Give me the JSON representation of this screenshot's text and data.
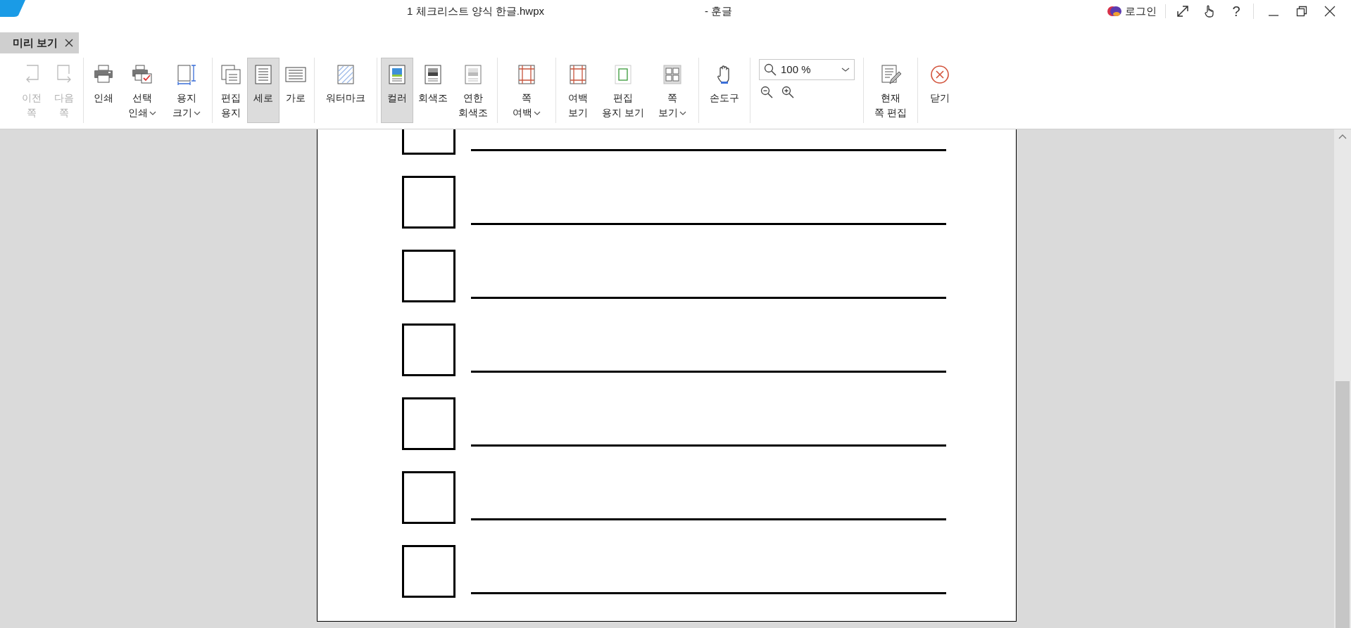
{
  "window": {
    "title": "1 체크리스트 양식 한글.hwpx",
    "app_name": "- 훈글",
    "login": "로그인",
    "help": "?"
  },
  "tabs": [
    {
      "label": "미리 보기",
      "selected": true
    }
  ],
  "toolbar": [
    {
      "kind": "buttons",
      "items": [
        {
          "lines": [
            "이전",
            "쪽"
          ],
          "disabled": true,
          "selected": false,
          "dropdown": false
        },
        {
          "lines": [
            "다음",
            "쪽"
          ],
          "disabled": true,
          "selected": false,
          "dropdown": false
        }
      ]
    },
    {
      "kind": "buttons",
      "items": [
        {
          "lines": [
            "인쇄"
          ],
          "disabled": false,
          "selected": false,
          "dropdown": false
        },
        {
          "lines": [
            "선택",
            "인쇄"
          ],
          "disabled": false,
          "selected": false,
          "dropdown": true
        },
        {
          "lines": [
            "용지",
            "크기"
          ],
          "disabled": false,
          "selected": false,
          "dropdown": true
        }
      ]
    },
    {
      "kind": "buttons",
      "items": [
        {
          "lines": [
            "편집",
            "용지"
          ],
          "disabled": false,
          "selected": false,
          "dropdown": false
        },
        {
          "lines": [
            "세로"
          ],
          "disabled": false,
          "selected": true,
          "dropdown": false
        },
        {
          "lines": [
            "가로"
          ],
          "disabled": false,
          "selected": false,
          "dropdown": false
        }
      ]
    },
    {
      "kind": "buttons",
      "items": [
        {
          "lines": [
            "워터마크"
          ],
          "disabled": false,
          "selected": false,
          "dropdown": false
        }
      ]
    },
    {
      "kind": "buttons",
      "items": [
        {
          "lines": [
            "컬러"
          ],
          "disabled": false,
          "selected": true,
          "dropdown": false
        },
        {
          "lines": [
            "회색조"
          ],
          "disabled": false,
          "selected": false,
          "dropdown": false
        },
        {
          "lines": [
            "연한",
            "회색조"
          ],
          "disabled": false,
          "selected": false,
          "dropdown": false
        }
      ]
    },
    {
      "kind": "buttons",
      "items": [
        {
          "lines": [
            "쪽",
            "여백"
          ],
          "disabled": false,
          "selected": false,
          "dropdown": true
        }
      ]
    },
    {
      "kind": "buttons",
      "items": [
        {
          "lines": [
            "여백",
            "보기"
          ],
          "disabled": false,
          "selected": false,
          "dropdown": false
        },
        {
          "lines": [
            "편집",
            "용지 보기"
          ],
          "disabled": false,
          "selected": false,
          "dropdown": false
        },
        {
          "lines": [
            "쪽",
            "보기"
          ],
          "disabled": false,
          "selected": false,
          "dropdown": true
        }
      ]
    },
    {
      "kind": "buttons",
      "items": [
        {
          "lines": [
            "손도구"
          ],
          "disabled": false,
          "selected": false,
          "dropdown": false
        }
      ]
    },
    {
      "kind": "zoom",
      "value": "100 %"
    },
    {
      "kind": "buttons",
      "items": [
        {
          "lines": [
            "현재",
            "쪽 편집"
          ],
          "disabled": false,
          "selected": false,
          "dropdown": false
        }
      ]
    },
    {
      "kind": "buttons",
      "items": [
        {
          "lines": [
            "닫기"
          ],
          "disabled": false,
          "selected": false,
          "dropdown": false
        }
      ]
    }
  ],
  "checklist": [
    {
      "checked": false
    },
    {
      "checked": false
    },
    {
      "checked": false
    },
    {
      "checked": false
    },
    {
      "checked": false
    },
    {
      "checked": false
    },
    {
      "checked": false
    }
  ]
}
